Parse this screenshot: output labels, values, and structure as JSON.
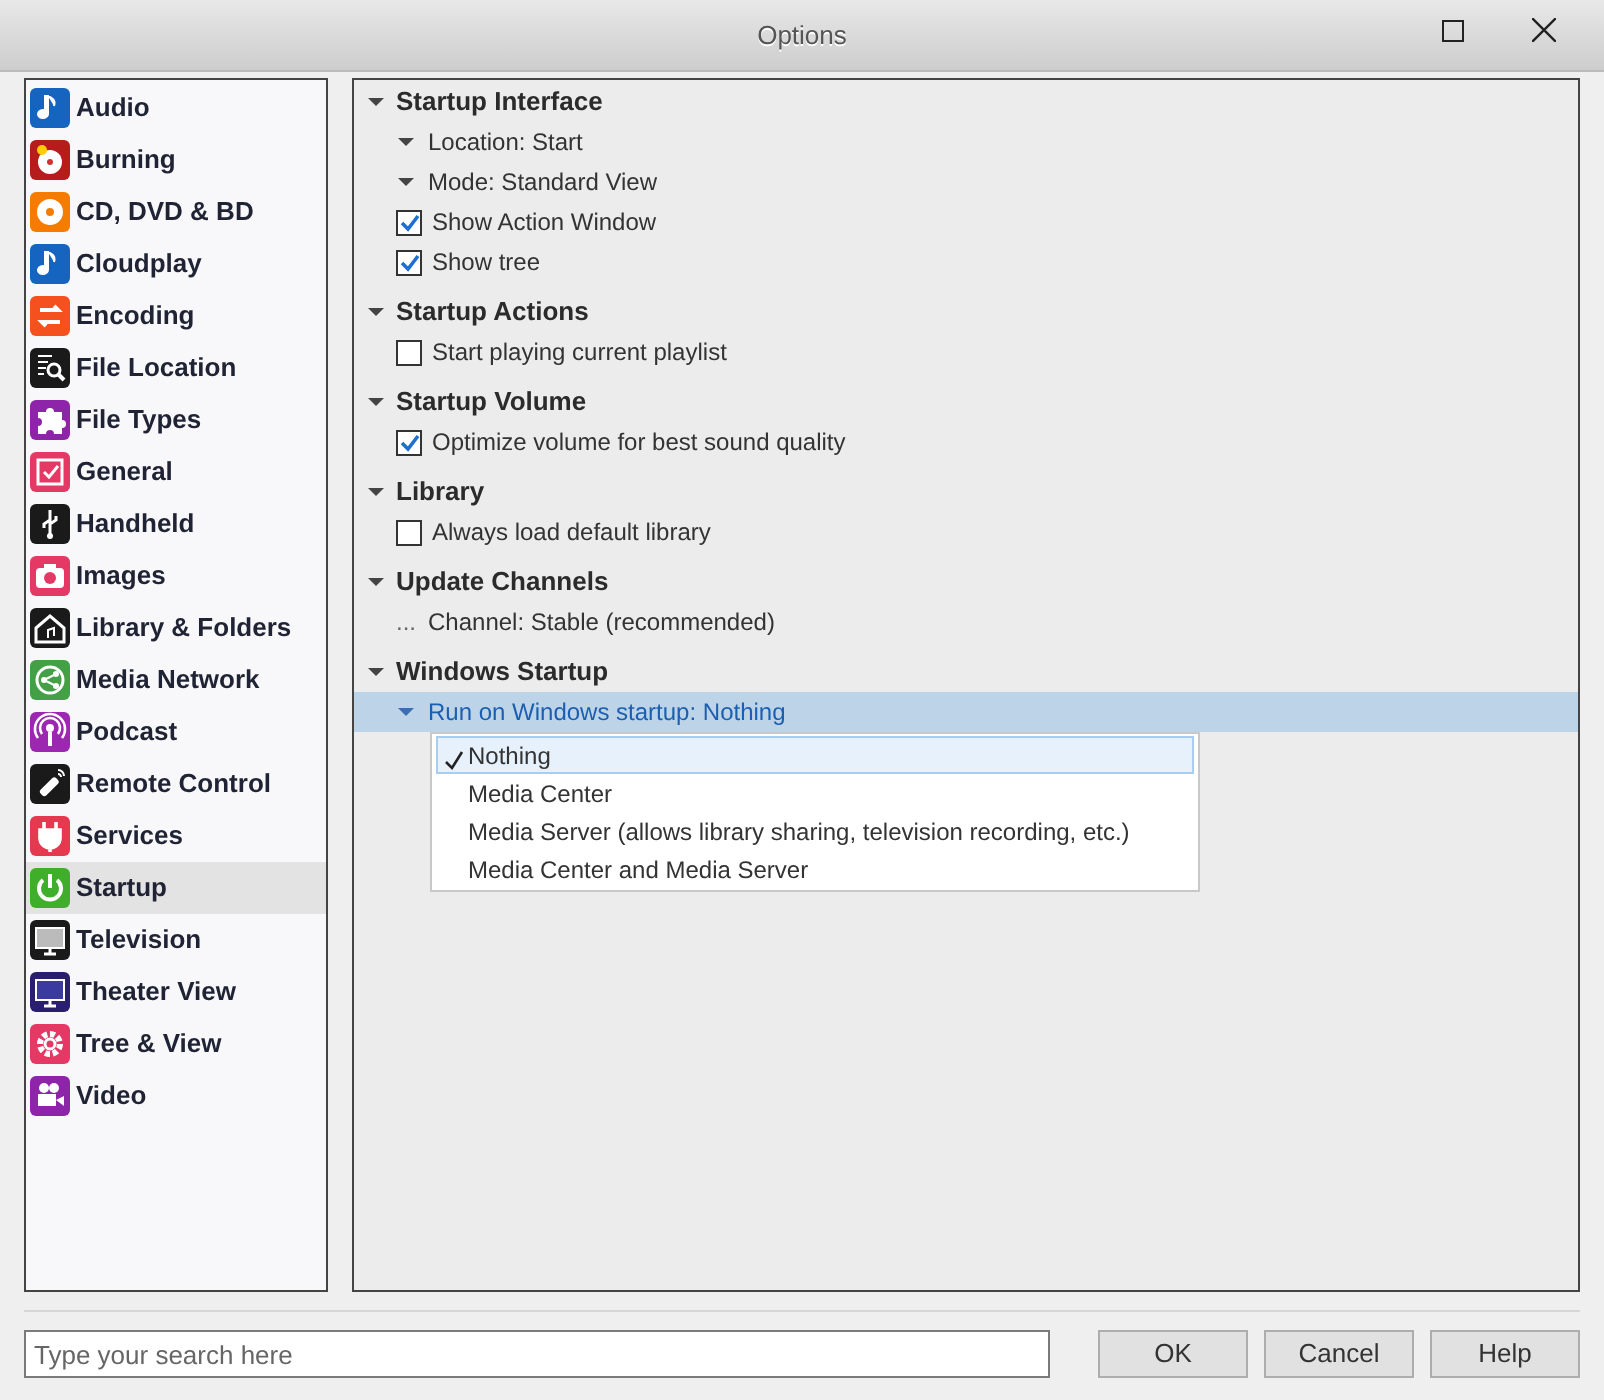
{
  "window": {
    "title": "Options"
  },
  "sidebar": {
    "items": [
      {
        "label": "Audio",
        "color": "#1565c0",
        "selected": false
      },
      {
        "label": "Burning",
        "color": "#b71c1c",
        "selected": false
      },
      {
        "label": "CD, DVD & BD",
        "color": "#f57c00",
        "selected": false
      },
      {
        "label": "Cloudplay",
        "color": "#1565c0",
        "selected": false
      },
      {
        "label": "Encoding",
        "color": "#f4511e",
        "selected": false
      },
      {
        "label": "File Location",
        "color": "#1a1a1a",
        "selected": false
      },
      {
        "label": "File Types",
        "color": "#8e24aa",
        "selected": false
      },
      {
        "label": "General",
        "color": "#e53965",
        "selected": false
      },
      {
        "label": "Handheld",
        "color": "#1a1a1a",
        "selected": false
      },
      {
        "label": "Images",
        "color": "#e53965",
        "selected": false
      },
      {
        "label": "Library & Folders",
        "color": "#1a1a1a",
        "selected": false
      },
      {
        "label": "Media Network",
        "color": "#43a047",
        "selected": false
      },
      {
        "label": "Podcast",
        "color": "#9c27b0",
        "selected": false
      },
      {
        "label": "Remote Control",
        "color": "#1a1a1a",
        "selected": false
      },
      {
        "label": "Services",
        "color": "#e53950",
        "selected": false
      },
      {
        "label": "Startup",
        "color": "#3fae2a",
        "selected": true
      },
      {
        "label": "Television",
        "color": "#1a1a1a",
        "selected": false
      },
      {
        "label": "Theater View",
        "color": "#2a1f6e",
        "selected": false
      },
      {
        "label": "Tree & View",
        "color": "#e53965",
        "selected": false
      },
      {
        "label": "Video",
        "color": "#8e24aa",
        "selected": false
      }
    ]
  },
  "sections": [
    {
      "title": "Startup Interface",
      "expanded": true,
      "items": [
        {
          "kind": "choice",
          "label": "Location: Start",
          "selected": false
        },
        {
          "kind": "choice",
          "label": "Mode: Standard View",
          "selected": false
        },
        {
          "kind": "checkbox",
          "label": "Show Action Window",
          "checked": true
        },
        {
          "kind": "checkbox",
          "label": "Show tree",
          "checked": true
        }
      ]
    },
    {
      "title": "Startup Actions",
      "expanded": true,
      "items": [
        {
          "kind": "checkbox",
          "label": "Start playing current playlist",
          "checked": false
        }
      ]
    },
    {
      "title": "Startup Volume",
      "expanded": true,
      "items": [
        {
          "kind": "checkbox",
          "label": "Optimize volume for best sound quality",
          "checked": true
        }
      ]
    },
    {
      "title": "Library",
      "expanded": true,
      "items": [
        {
          "kind": "checkbox",
          "label": "Always load default library",
          "checked": false
        }
      ]
    },
    {
      "title": "Update Channels",
      "expanded": true,
      "items": [
        {
          "kind": "info",
          "marker": "...",
          "label": "Channel: Stable (recommended)"
        }
      ]
    },
    {
      "title": "Windows Startup",
      "expanded": true,
      "items": [
        {
          "kind": "choice",
          "label": "Run on Windows startup: Nothing",
          "selected": true,
          "menu": [
            {
              "label": "Nothing",
              "selected": true
            },
            {
              "label": "Media Center",
              "selected": false
            },
            {
              "label": "Media Server (allows library sharing, television recording, etc.)",
              "selected": false
            },
            {
              "label": "Media Center and Media Server",
              "selected": false
            }
          ]
        }
      ]
    }
  ],
  "search": {
    "placeholder": "Type your search here"
  },
  "buttons": [
    "OK",
    "Cancel",
    "Help"
  ]
}
